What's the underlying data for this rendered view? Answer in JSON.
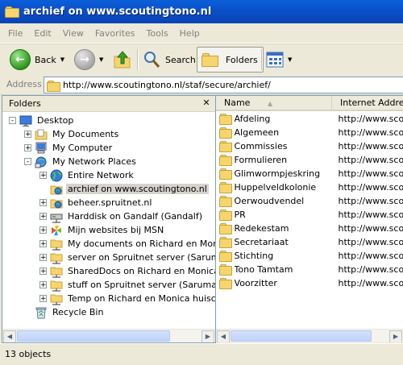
{
  "window": {
    "title": "archief on www.scoutingtono.nl"
  },
  "menu": [
    "File",
    "Edit",
    "View",
    "Favorites",
    "Tools",
    "Help"
  ],
  "toolbar": {
    "back_label": "Back",
    "search_label": "Search",
    "folders_label": "Folders"
  },
  "address": {
    "label": "Address",
    "value": "http://www.scoutingtono.nl/staf/secure/archief/"
  },
  "left_pane": {
    "title": "Folders",
    "tree": [
      {
        "label": "Desktop",
        "icon": "desktop-icon",
        "expander": "-"
      },
      {
        "label": "My Documents",
        "icon": "my-documents-icon",
        "expander": "+"
      },
      {
        "label": "My Computer",
        "icon": "my-computer-icon",
        "expander": "+"
      },
      {
        "label": "My Network Places",
        "icon": "network-places-icon",
        "expander": "-"
      },
      {
        "label": "Entire Network",
        "icon": "globe-icon",
        "expander": "+"
      },
      {
        "label": "archief on www.scoutingtono.nl",
        "icon": "web-folder-icon",
        "expander": "",
        "selected": true
      },
      {
        "label": "beheer.spruitnet.nl",
        "icon": "web-folder-icon",
        "expander": "+"
      },
      {
        "label": "Harddisk on Gandalf (Gandalf)",
        "icon": "network-drive-icon",
        "expander": "+"
      },
      {
        "label": "Mijn websites bij MSN",
        "icon": "msn-icon",
        "expander": "+"
      },
      {
        "label": "My documents on Richard en Monica huisc",
        "icon": "shared-folder-icon",
        "expander": "+"
      },
      {
        "label": "server on Spruitnet server (Saruman)",
        "icon": "shared-folder-icon",
        "expander": "+"
      },
      {
        "label": "SharedDocs on Richard en Monica huiscor",
        "icon": "shared-folder-icon",
        "expander": "+"
      },
      {
        "label": "stuff on Spruitnet server (Saruman)",
        "icon": "shared-folder-icon",
        "expander": "+"
      },
      {
        "label": "Temp on Richard en Monica huiscomputer",
        "icon": "shared-folder-icon",
        "expander": "+"
      },
      {
        "label": "Recycle Bin",
        "icon": "recycle-bin-icon",
        "expander": ""
      }
    ]
  },
  "right_pane": {
    "columns": [
      "Name",
      "Internet Address"
    ],
    "files": [
      {
        "name": "Afdeling",
        "address": "http://www.scou"
      },
      {
        "name": "Algemeen",
        "address": "http://www.scou"
      },
      {
        "name": "Commissies",
        "address": "http://www.scou"
      },
      {
        "name": "Formulieren",
        "address": "http://www.scou"
      },
      {
        "name": "Glimwormpjeskring",
        "address": "http://www.scou"
      },
      {
        "name": "Huppelveldkolonie",
        "address": "http://www.scou"
      },
      {
        "name": "Oerwoudvendel",
        "address": "http://www.scou"
      },
      {
        "name": "PR",
        "address": "http://www.scou"
      },
      {
        "name": "Redekestam",
        "address": "http://www.scou"
      },
      {
        "name": "Secretariaat",
        "address": "http://www.scou"
      },
      {
        "name": "Stichting",
        "address": "http://www.scou"
      },
      {
        "name": "Tono Tamtam",
        "address": "http://www.scou"
      },
      {
        "name": "Voorzitter",
        "address": "http://www.scou"
      }
    ]
  },
  "status": {
    "text": "13 objects"
  },
  "colors": {
    "title_bar": "#0a4cc4",
    "selection": "#d6d3ce",
    "folder": "#f6d56e"
  }
}
